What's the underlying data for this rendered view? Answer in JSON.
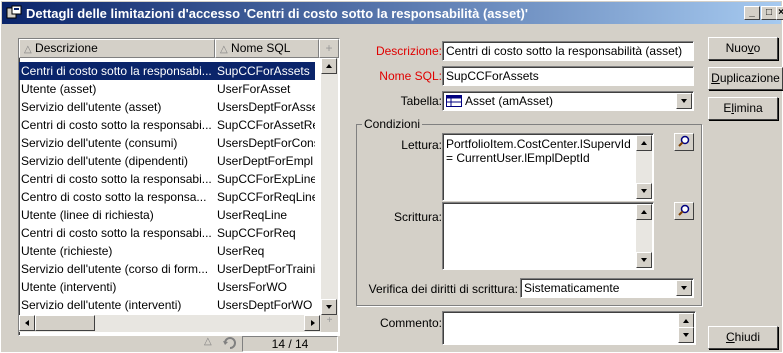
{
  "window": {
    "title": "Dettagli delle limitazioni d'accesso 'Centri di costo sotto la responsabilità (asset)'",
    "controls": {
      "minimize": "_",
      "maximize": "□",
      "close": "×"
    }
  },
  "list": {
    "columns": [
      "Descrizione",
      "Nome SQL"
    ],
    "rows": [
      {
        "desc": "Centri di costo sotto la responsabi...",
        "sql": "SupCCForAssets",
        "selected": true
      },
      {
        "desc": "Utente (asset)",
        "sql": "UserForAsset"
      },
      {
        "desc": "Servizio dell'utente (asset)",
        "sql": "UsersDeptForAsset"
      },
      {
        "desc": "Centri di costo sotto la responsabi...",
        "sql": "SupCCForAssetRen"
      },
      {
        "desc": "Servizio dell'utente (consumi)",
        "sql": "UsersDeptForCons"
      },
      {
        "desc": "Servizio dell'utente (dipendenti)",
        "sql": "UserDeptForEmpl"
      },
      {
        "desc": "Centri di costo sotto la responsabi...",
        "sql": "SupCCForExpLine"
      },
      {
        "desc": "Centro di costo sotto la responsa...",
        "sql": "SupCCForReqLine"
      },
      {
        "desc": "Utente (linee di richiesta)",
        "sql": "UserReqLine"
      },
      {
        "desc": "Centri di costo sotto la responsabi...",
        "sql": "SupCCForReq"
      },
      {
        "desc": "Utente (richieste)",
        "sql": "UserReq"
      },
      {
        "desc": "Servizio dell'utente (corso di form...",
        "sql": "UserDeptForTrainin"
      },
      {
        "desc": "Utente (interventi)",
        "sql": "UsersForWO"
      },
      {
        "desc": "Servizio dell'utente (interventi)",
        "sql": "UsersDeptForWO"
      }
    ],
    "counter": "14 / 14"
  },
  "form": {
    "descrizione_label": "Descrizione:",
    "descrizione_value": "Centri di costo sotto la responsabilità (asset)",
    "nome_sql_label": "Nome SQL:",
    "nome_sql_value": "SupCCForAssets",
    "tabella_label": "Tabella:",
    "tabella_value": "Asset (amAsset)",
    "condizioni_label": "Condizioni",
    "lettura_label": "Lettura:",
    "lettura_value": "PortfolioItem.CostCenter.lSupervId = CurrentUser.lEmplDeptId",
    "scrittura_label": "Scrittura:",
    "scrittura_value": "",
    "verifica_label": "Verifica dei diritti di scrittura:",
    "verifica_value": "Sistematicamente",
    "commento_label": "Commento:",
    "commento_value": ""
  },
  "buttons": {
    "nuovo_pre": "Nuo",
    "nuovo_u": "v",
    "nuovo_post": "o",
    "dup_pre": "",
    "dup_u": "D",
    "dup_post": "uplicazione",
    "elimina_pre": "E",
    "elimina_u": "l",
    "elimina_post": "imina",
    "chiudi_pre": "",
    "chiudi_u": "C",
    "chiudi_post": "hiudi"
  },
  "colors": {
    "titlebar": "#0a246a",
    "selection": "#0a246a",
    "required_label": "#e00000"
  },
  "icons": [
    "app-icon",
    "sort-icon",
    "table-icon",
    "search-icon",
    "refresh-icon"
  ]
}
